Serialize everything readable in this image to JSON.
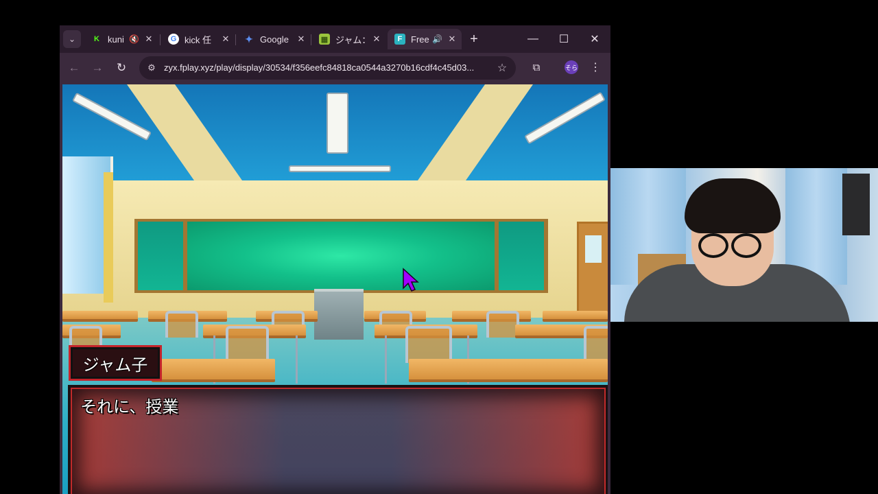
{
  "browser": {
    "tabs": [
      {
        "title": "kuni",
        "favicon": "K",
        "favicon_color": "#53fc18",
        "status_icon": "muted-speaker-icon",
        "active": false
      },
      {
        "title": "kick 任",
        "favicon": "G",
        "favicon_color": "#4285f4",
        "status_icon": "",
        "active": false
      },
      {
        "title": "Google",
        "favicon": "✦",
        "favicon_color": "#5b8def",
        "status_icon": "",
        "active": false
      },
      {
        "title": "ジャム：",
        "favicon": "▦",
        "favicon_color": "#9bc53d",
        "status_icon": "",
        "active": false
      },
      {
        "title": "Free",
        "favicon": "F",
        "favicon_color": "#2bb3c0",
        "status_icon": "speaker-icon",
        "active": true
      }
    ],
    "url": "zyx.fplay.xyz/play/display/30534/f356eefc84818ca0544a3270b16cdf4c45d03...",
    "profile_initials": "そら"
  },
  "game": {
    "speaker_name": "ジャム子",
    "dialogue": "それに、授業",
    "scene": "classroom",
    "colors": {
      "name_box_border": "#c4242b",
      "chalkboard": "#13c08a"
    }
  },
  "webcam": {
    "present": true
  }
}
